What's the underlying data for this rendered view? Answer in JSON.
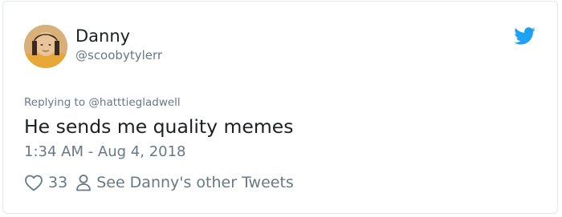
{
  "author": {
    "display_name": "Danny",
    "screen_name": "@scoobytylerr"
  },
  "tweet": {
    "replying_to": "Replying to @hatttiegladwell",
    "text": "He sends me quality memes",
    "timestamp": "1:34 AM - Aug 4, 2018"
  },
  "actions": {
    "like_count": "33",
    "profile_link": "See Danny's other Tweets"
  },
  "icons": {
    "logo": "twitter-bird-icon",
    "like": "heart-icon",
    "profile": "person-icon"
  },
  "colors": {
    "brand": "#1da1f2",
    "text": "#1c2022",
    "secondary_text": "#697882",
    "border": "#e1e8ed"
  }
}
